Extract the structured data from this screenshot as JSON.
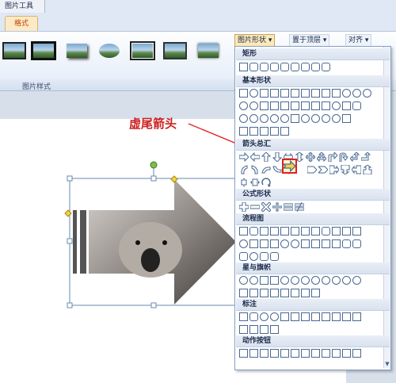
{
  "ribbon": {
    "tool_title": "图片工具",
    "tab_format": "格式",
    "group_label": "图片样式",
    "btn_picture_shape": "图片形状 ▾",
    "btn_bring_front": "置于顶层 ▾",
    "btn_align": "对齐 ▾"
  },
  "annotation": {
    "text": "虚尾箭头",
    "color": "#cc2020"
  },
  "dropdown": {
    "sections": [
      "矩形",
      "基本形状",
      "箭头总汇",
      "公式形状",
      "流程图",
      "星与旗帜",
      "标注",
      "动作按钮"
    ]
  },
  "colors": {
    "accent": "#fde9b9",
    "highlight": "#e02020",
    "arrow_fill": "#f2d24a"
  }
}
